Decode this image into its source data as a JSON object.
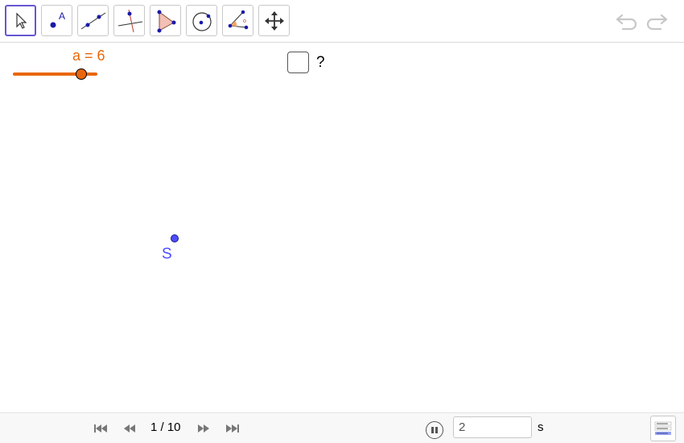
{
  "toolbar": {
    "tools": [
      {
        "name": "move-tool",
        "icon": "arrow-cursor-icon",
        "active": true
      },
      {
        "name": "point-tool",
        "icon": "point-icon",
        "letter": "A"
      },
      {
        "name": "line-tool",
        "icon": "line-icon"
      },
      {
        "name": "perpendicular-line-tool",
        "icon": "perpendicular-line-icon"
      },
      {
        "name": "polygon-tool",
        "icon": "polygon-icon"
      },
      {
        "name": "circle-tool",
        "icon": "circle-icon"
      },
      {
        "name": "angle-tool",
        "icon": "angle-icon"
      },
      {
        "name": "move-graphics-view-tool",
        "icon": "move-cross-icon"
      }
    ],
    "undo_icon": "undo-icon",
    "redo_icon": "redo-icon"
  },
  "graphics": {
    "slider": {
      "label": "a = 6",
      "value": 6,
      "color": "#e8670c"
    },
    "checkbox": {
      "checked": false,
      "label": "?"
    },
    "point": {
      "label": "S",
      "color": "#4d4dff"
    }
  },
  "playbar": {
    "page_counter": "1 / 10",
    "time_value": "2",
    "time_unit": "s",
    "icons": [
      "first-page-icon",
      "previous-page-icon",
      "next-page-icon",
      "last-page-icon",
      "pause-icon",
      "algebra-view-icon"
    ]
  }
}
